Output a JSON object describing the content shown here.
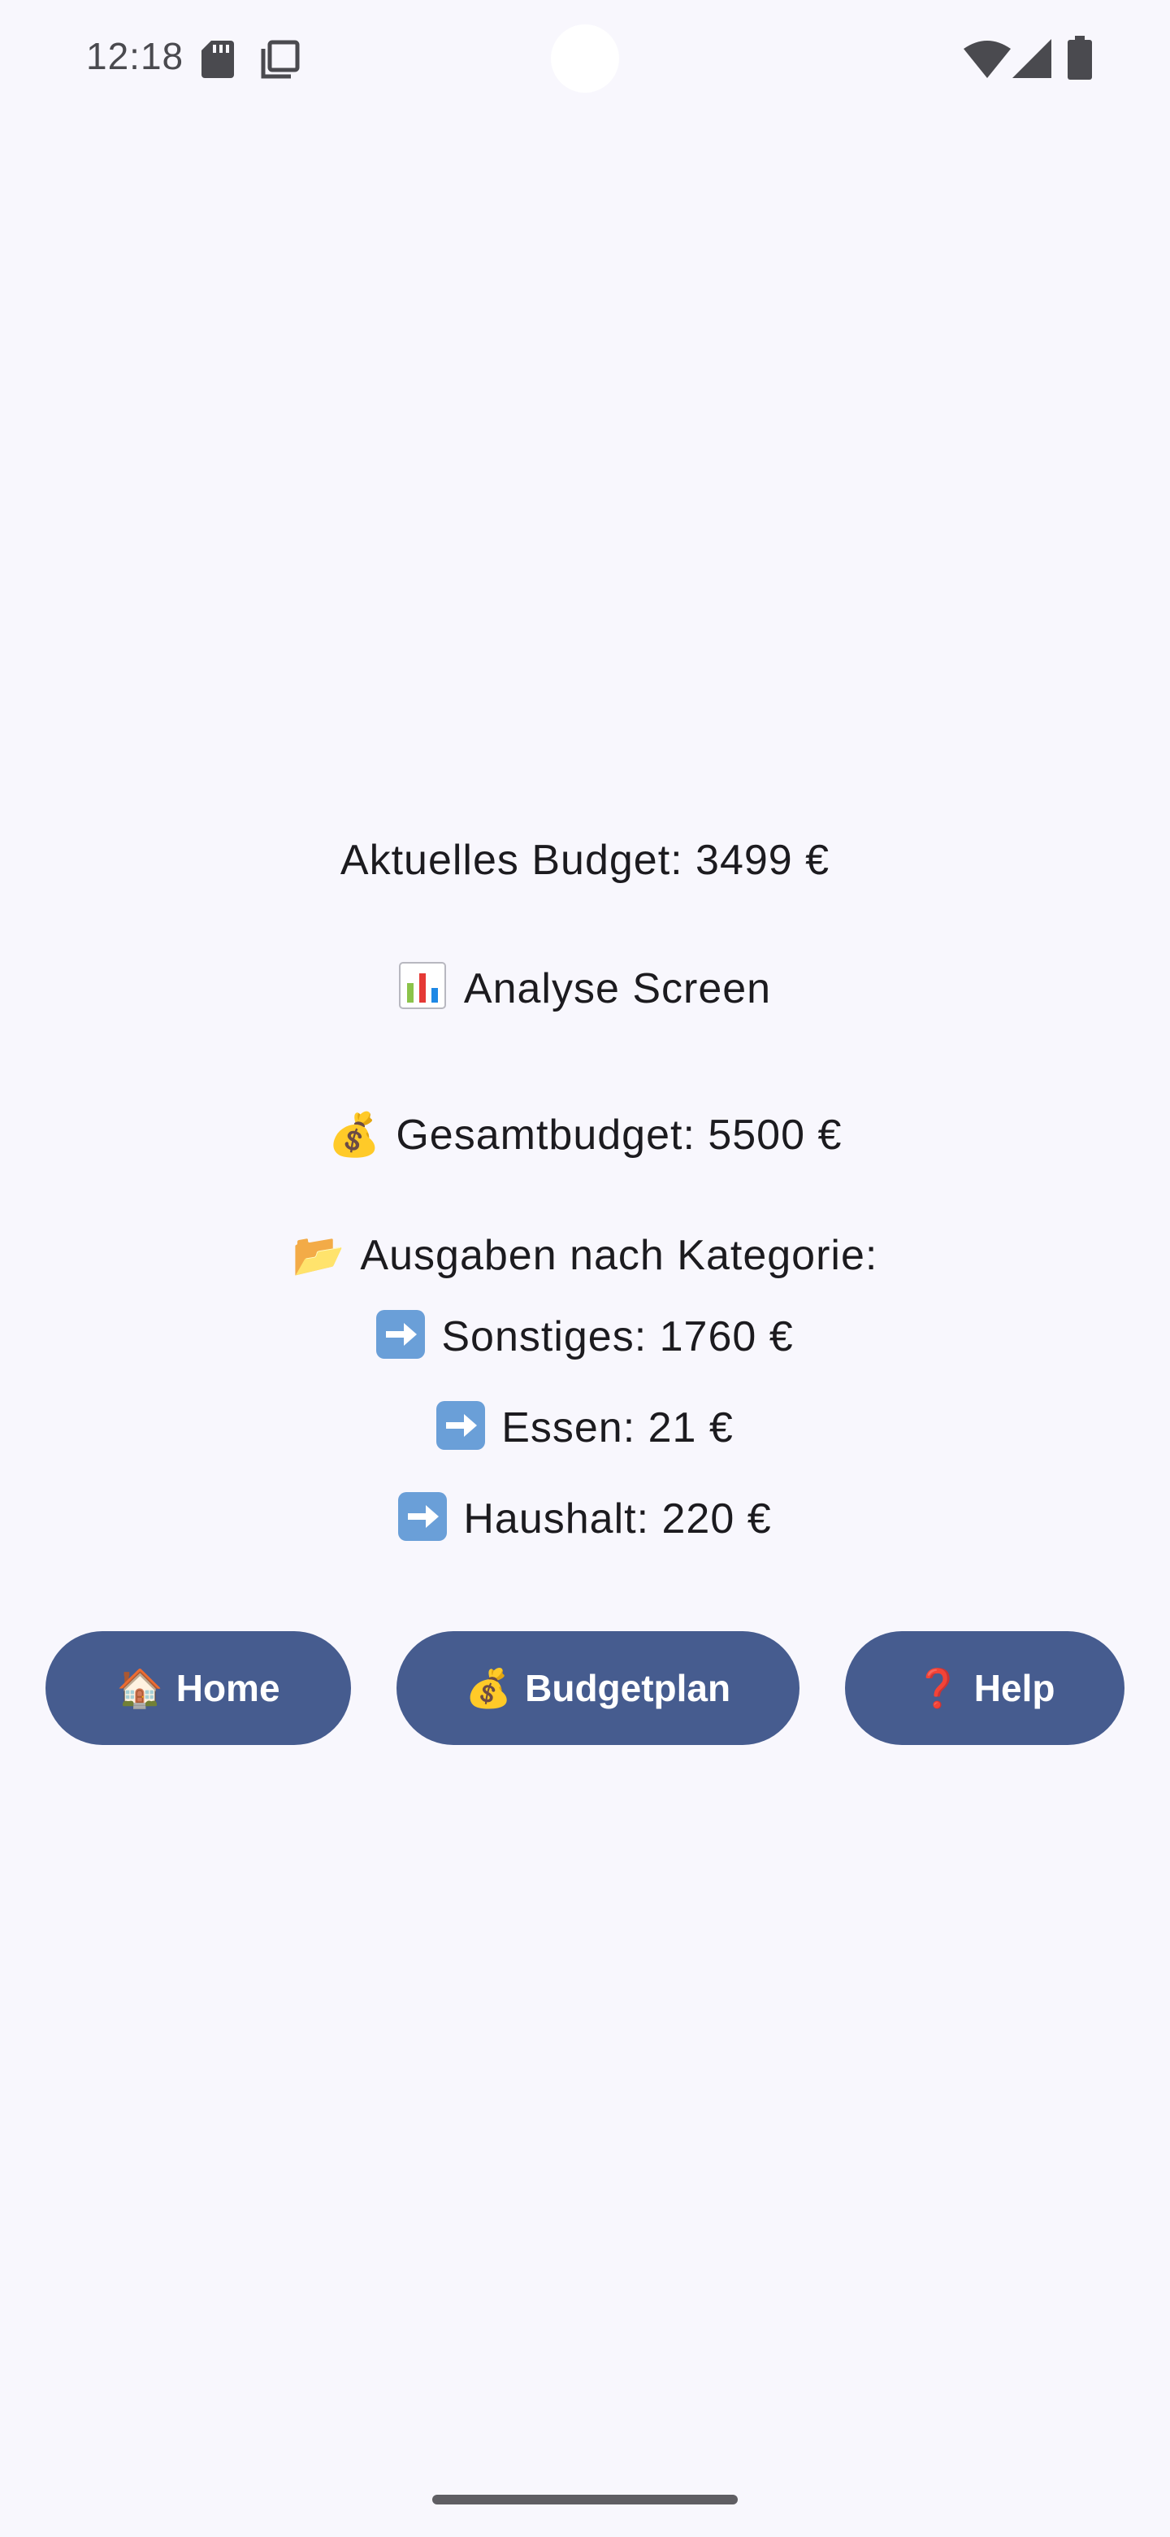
{
  "status_bar": {
    "time": "12:18",
    "icons": [
      "sd-card-icon",
      "copy-icon",
      "wifi-icon",
      "cell-signal-icon",
      "battery-icon"
    ]
  },
  "main": {
    "current_budget": "Aktuelles Budget: 3499 €",
    "title_emoji": "📊",
    "title": "Analyse Screen",
    "total_emoji": "💰",
    "total_budget": "Gesamtbudget: 5500 €",
    "category_emoji": "📂",
    "category_header": "Ausgaben nach Kategorie:",
    "categories": [
      {
        "icon": "right-arrow-icon",
        "text": "Sonstiges: 1760 €"
      },
      {
        "icon": "right-arrow-icon",
        "text": "Essen: 21 €"
      },
      {
        "icon": "right-arrow-icon",
        "text": "Haushalt: 220 €"
      }
    ]
  },
  "nav": {
    "home": {
      "emoji": "🏠",
      "label": "Home"
    },
    "budget": {
      "emoji": "💰",
      "label": "Budgetplan"
    },
    "help": {
      "emoji": "❓",
      "label": "Help"
    }
  },
  "colors": {
    "background": "#f8f7fd",
    "button": "#465c8f",
    "button_text": "#ffffff",
    "text": "#1c1b1f"
  }
}
